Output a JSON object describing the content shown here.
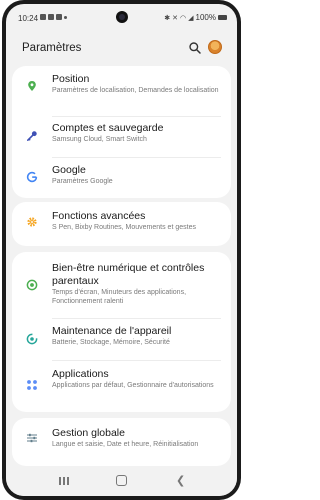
{
  "status": {
    "time": "10:24",
    "battery": "100%"
  },
  "header": {
    "title": "Paramètres"
  },
  "items": [
    {
      "title": "Position",
      "subtitle": "Paramètres de localisation, Demandes de localisation",
      "icon": "location-pin-icon",
      "color": "#4caf50"
    },
    {
      "title": "Comptes et sauvegarde",
      "subtitle": "Samsung Cloud, Smart Switch",
      "icon": "key-icon",
      "color": "#3f51b5"
    },
    {
      "title": "Google",
      "subtitle": "Paramètres Google",
      "icon": "google-icon",
      "color": "#4285f4"
    },
    {
      "title": "Fonctions avancées",
      "subtitle": "S Pen, Bixby Routines, Mouvements et gestes",
      "icon": "gear-plus-icon",
      "color": "#f5a623"
    },
    {
      "title": "Bien-être numérique et contrôles parentaux",
      "subtitle": "Temps d'écran, Minuteurs des applications, Fonctionnement ralenti",
      "icon": "wellbeing-icon",
      "color": "#4caf50"
    },
    {
      "title": "Maintenance de l'appareil",
      "subtitle": "Batterie, Stockage, Mémoire, Sécurité",
      "icon": "device-care-icon",
      "color": "#26a69a"
    },
    {
      "title": "Applications",
      "subtitle": "Applications par défaut, Gestionnaire d'autorisations",
      "icon": "apps-icon",
      "color": "#5c8df6"
    },
    {
      "title": "Gestion globale",
      "subtitle": "Langue et saisie, Date et heure, Réinitialisation",
      "icon": "sliders-icon",
      "color": "#607d8b"
    }
  ]
}
